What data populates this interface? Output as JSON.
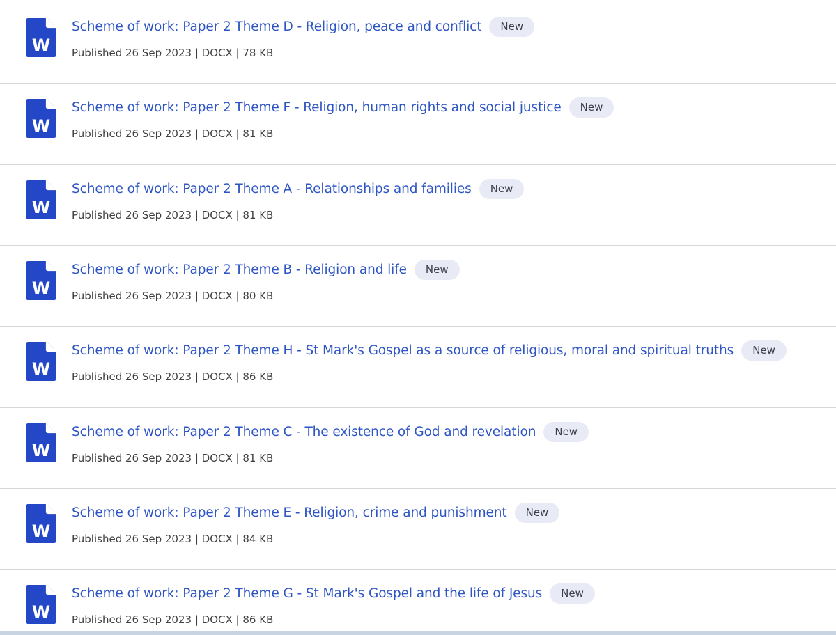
{
  "icon": {
    "name": "word-document-icon",
    "color": "#2347c6",
    "letter": "W"
  },
  "colors": {
    "link": "#2e55c4",
    "badge_bg": "#e8ebf5",
    "divider": "#d6d6d6"
  },
  "resources": [
    {
      "title": "Scheme of work: Paper 2 Theme D - Religion, peace and conflict",
      "badge": "New",
      "meta": "Published 26 Sep 2023 | DOCX | 78 KB"
    },
    {
      "title": "Scheme of work: Paper 2 Theme F - Religion, human rights and social justice",
      "badge": "New",
      "meta": "Published 26 Sep 2023 | DOCX | 81 KB"
    },
    {
      "title": "Scheme of work: Paper 2 Theme A - Relationships and families",
      "badge": "New",
      "meta": "Published 26 Sep 2023 | DOCX | 81 KB"
    },
    {
      "title": "Scheme of work: Paper 2 Theme B - Religion and life",
      "badge": "New",
      "meta": "Published 26 Sep 2023 | DOCX | 80 KB"
    },
    {
      "title": "Scheme of work: Paper 2 Theme H - St Mark's Gospel as a source of religious, moral and spiritual truths",
      "badge": "New",
      "meta": "Published 26 Sep 2023 | DOCX | 86 KB"
    },
    {
      "title": "Scheme of work: Paper 2 Theme C - The existence of God and revelation",
      "badge": "New",
      "meta": "Published 26 Sep 2023 | DOCX | 81 KB"
    },
    {
      "title": "Scheme of work: Paper 2 Theme E - Religion, crime and punishment",
      "badge": "New",
      "meta": "Published 26 Sep 2023 | DOCX | 84 KB"
    },
    {
      "title": "Scheme of work: Paper 2 Theme G - St Mark's Gospel and the life of Jesus",
      "badge": "New",
      "meta": "Published 26 Sep 2023 | DOCX | 86 KB"
    }
  ]
}
